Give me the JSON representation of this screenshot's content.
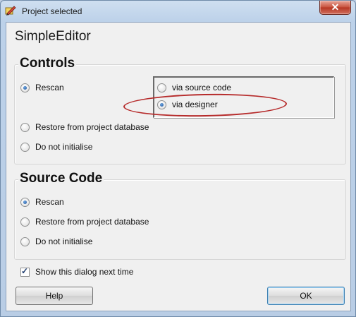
{
  "window": {
    "title": "Project selected",
    "close_glyph": "✕"
  },
  "app_name": "SimpleEditor",
  "controls": {
    "title": "Controls",
    "options": [
      "Rescan",
      "Restore from project database",
      "Do not initialise"
    ],
    "selected": "Rescan",
    "sub_options": [
      "via source code",
      "via designer"
    ],
    "sub_selected": "via designer"
  },
  "source_code": {
    "title": "Source Code",
    "options": [
      "Rescan",
      "Restore from project database",
      "Do not initialise"
    ],
    "selected": "Rescan"
  },
  "show_dialog": {
    "label": "Show this dialog next time",
    "checked": true
  },
  "buttons": {
    "help": "Help",
    "ok": "OK"
  },
  "colors": {
    "highlight_ring": "#b62b2b",
    "titlebar": "#bcd1e9",
    "close": "#c7503b"
  }
}
